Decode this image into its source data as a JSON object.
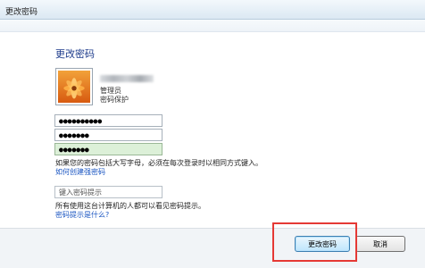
{
  "window": {
    "title": "更改密码"
  },
  "main": {
    "heading": "更改密码",
    "user": {
      "role": "管理员",
      "protection": "密码保护"
    },
    "fields": {
      "current_password": "●●●●●●●●●●",
      "new_password": "●●●●●●●",
      "confirm_password": "●●●●●●●"
    },
    "caps_note": "如果您的密码包括大写字母，必须在每次登录时以相同方式键入。",
    "create_strong_link": "如何创建强密码",
    "hint_placeholder": "键入密码提示",
    "hint_note": "所有使用这台计算机的人都可以看见密码提示。",
    "hint_link": "密码提示是什么?"
  },
  "footer": {
    "change_label": "更改密码",
    "cancel_label": "取消"
  },
  "colors": {
    "heading": "#1e3c8c",
    "link": "#1a55c2",
    "highlight": "#e53935",
    "confirm_field": "#dcf0d8"
  },
  "icons": {
    "avatar": "flower-avatar-icon"
  }
}
